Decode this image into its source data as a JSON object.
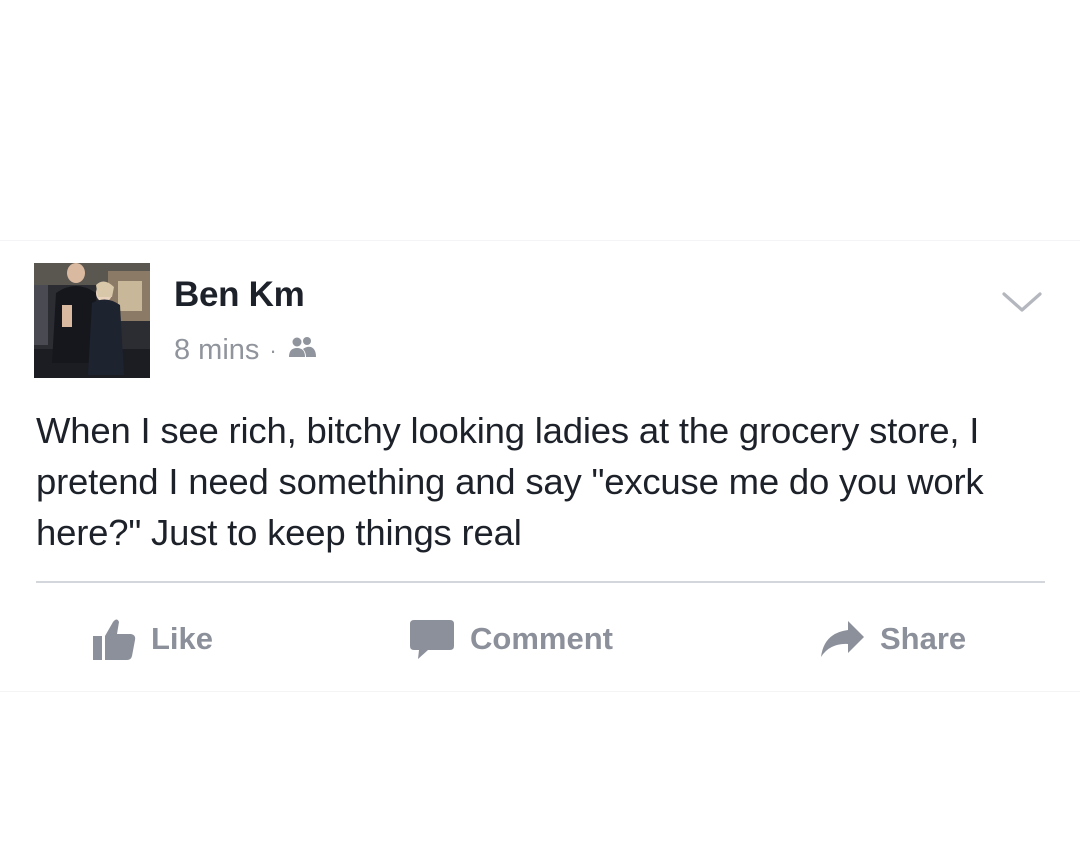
{
  "post": {
    "author": "Ben Km",
    "time": "8 mins",
    "separator": "·",
    "privacy_icon": "friends-icon",
    "text": "When I see rich, bitchy looking ladies at the grocery store, I pretend I need something and say \"excuse me do you work here?\" Just to keep things real",
    "menu_icon": "chevron-down-icon"
  },
  "actions": {
    "like_label": "Like",
    "comment_label": "Comment",
    "share_label": "Share"
  },
  "colors": {
    "text": "#1d2129",
    "meta": "#90949c",
    "action": "#8c909a",
    "divider": "#d3d6db"
  }
}
